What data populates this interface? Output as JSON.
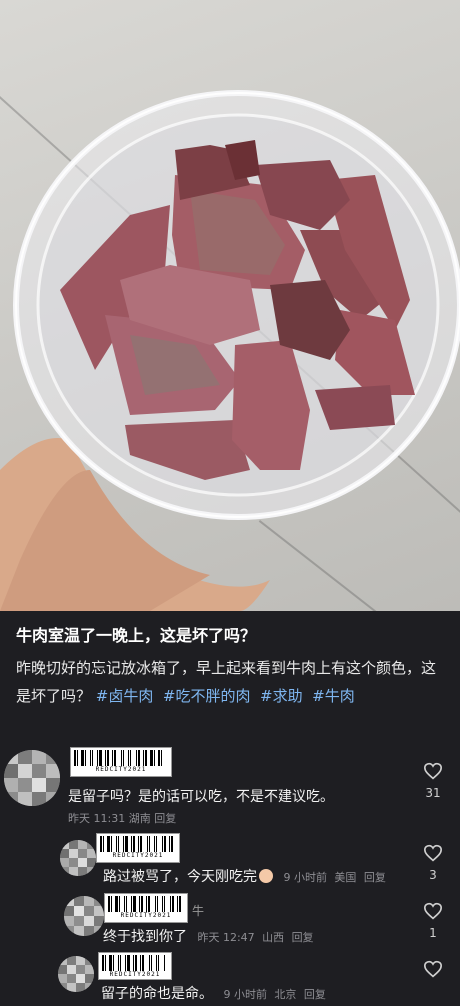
{
  "post": {
    "title": "牛肉室温了一晚上，这是坏了吗？",
    "body": "昨晚切好的忘记放冰箱了，早上起来看到牛肉上有这个颜色，这是坏了吗？",
    "tags": [
      "#卤牛肉",
      "#吃不胖的肉",
      "#求助",
      "#牛肉"
    ]
  },
  "watermark": "REDCITY2021",
  "comments": [
    {
      "text": "是留子吗？是的话可以吃，不是不建议吃。",
      "time": "昨天 11:31",
      "location": "湖南",
      "reply": "回复",
      "likes": "31"
    },
    {
      "text": "路过被骂了，今天刚吃完",
      "time": "9 小时前",
      "location": "美国",
      "reply": "回复",
      "likes": "3"
    },
    {
      "name_fragment": "牛",
      "text": "终于找到你了",
      "time": "昨天 12:47",
      "location": "山西",
      "reply": "回复",
      "likes": "1"
    },
    {
      "text": "留子的命也是命。",
      "time": "9 小时前",
      "location": "北京",
      "reply": "回复",
      "likes": ""
    }
  ]
}
